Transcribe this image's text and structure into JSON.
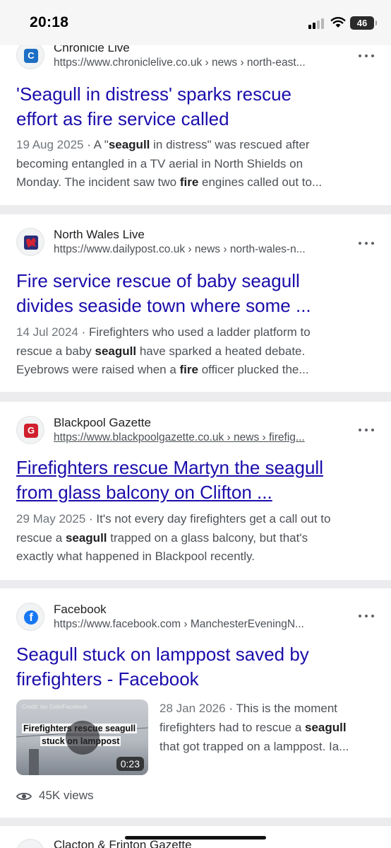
{
  "status_bar": {
    "time": "20:18",
    "battery": "46"
  },
  "results": [
    {
      "source": "Chronicle Live",
      "url": "https://www.chroniclelive.co.uk › news › north-east...",
      "favicon_letter": "C",
      "favicon_color": "#1d6fc4",
      "title_lines": [
        "'Seagull in distress' sparks rescue",
        "effort as fire service called"
      ],
      "snippet_lines": [
        [
          "19 Aug 2025",
          " · A \"",
          "seagull",
          " in distress\" was rescued after"
        ],
        [
          "becoming entangled in a TV aerial in North Shields on"
        ],
        [
          "Monday. The incident saw two ",
          "fire",
          " engines called out to..."
        ]
      ]
    },
    {
      "source": "North Wales Live",
      "url": "https://www.dailypost.co.uk › news › north-wales-n...",
      "favicon_letter": "",
      "favicon_color": "#c8202f",
      "title_lines": [
        "Fire service rescue of baby seagull",
        "divides seaside town where some ..."
      ],
      "snippet_lines": [
        [
          "14 Jul 2024",
          " · Firefighters who used a ladder platform to"
        ],
        [
          "rescue a baby ",
          "seagull",
          " have sparked a heated debate."
        ],
        [
          "Eyebrows were raised when a ",
          "fire",
          " officer plucked the..."
        ]
      ]
    },
    {
      "source": "Blackpool Gazette",
      "url": "https://www.blackpoolgazette.co.uk › news › firefig...",
      "favicon_letter": "G",
      "favicon_color": "#d0202e",
      "title_lines": [
        "Firefighters rescue Martyn the seagull",
        "from glass balcony on Clifton ..."
      ],
      "snippet_lines": [
        [
          "29 May 2025",
          " · It's not every day firefighters get a call out to"
        ],
        [
          "rescue a ",
          "seagull",
          " trapped on a glass balcony, but that's"
        ],
        [
          "exactly what happened in Blackpool recently."
        ]
      ]
    },
    {
      "source": "Facebook",
      "url": "https://www.facebook.com › ManchesterEveningN...",
      "favicon_letter": "f",
      "favicon_color": "#1877f2",
      "title_lines": [
        "Seagull stuck on lamppost saved by",
        "firefighters - Facebook"
      ],
      "video": {
        "credit": "Credit: Ian Dale/Facebook",
        "caption_1": "Firefighters rescue seagull",
        "caption_2": "stuck on lamppost",
        "duration": "0:23"
      },
      "snippet_lines": [
        [
          "28 Jan 2026",
          " · This is the moment"
        ],
        [
          "firefighters had to rescue a ",
          "seagull"
        ],
        [
          "that got trapped on a lamppost. Ia..."
        ]
      ],
      "views": "45K views"
    },
    {
      "source": "Clacton & Frinton Gazette"
    }
  ]
}
